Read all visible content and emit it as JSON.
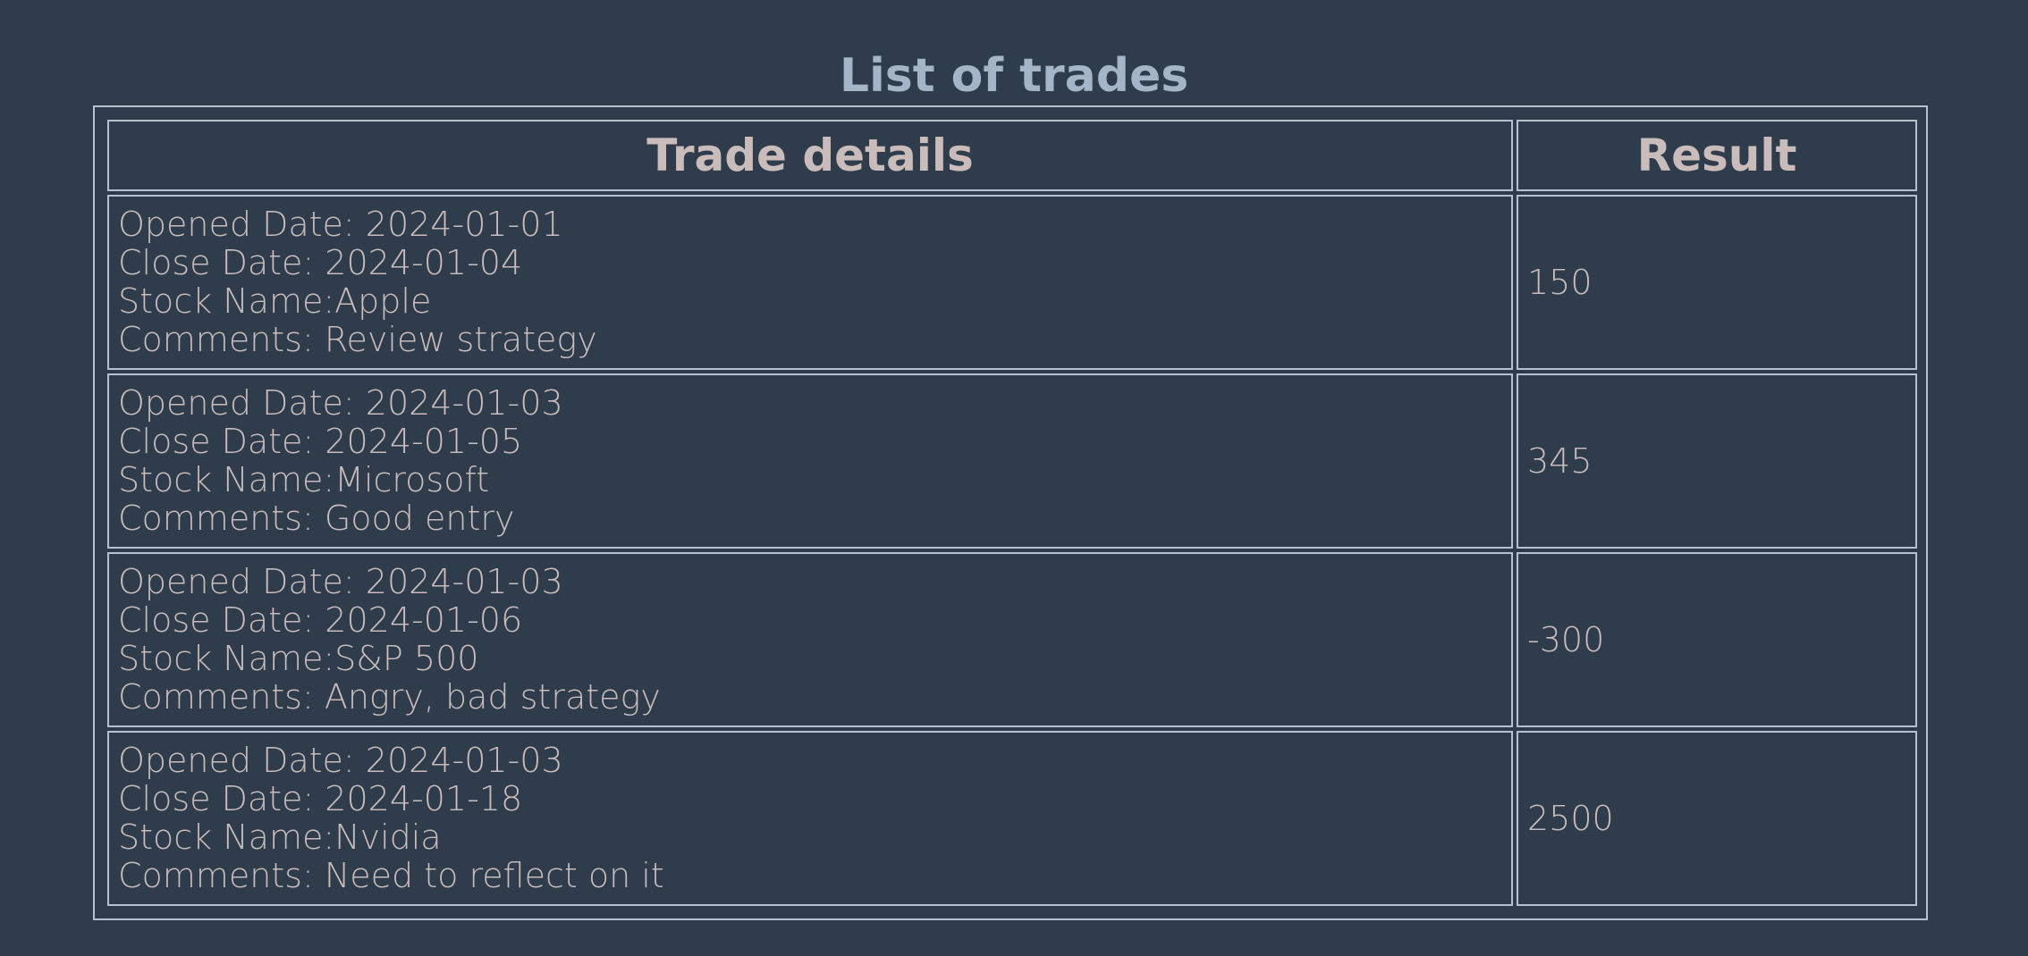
{
  "page": {
    "title": "List of trades"
  },
  "table": {
    "headers": {
      "details": "Trade details",
      "result": "Result"
    },
    "rows": [
      {
        "opened": "Opened Date: 2024-01-01",
        "closed": "Close Date: 2024-01-04",
        "stock": "Stock Name:Apple",
        "comments": "Comments: Review strategy",
        "result": "150"
      },
      {
        "opened": "Opened Date: 2024-01-03",
        "closed": "Close Date: 2024-01-05",
        "stock": "Stock Name:Microsoft",
        "comments": "Comments: Good entry",
        "result": "345"
      },
      {
        "opened": "Opened Date: 2024-01-03",
        "closed": "Close Date: 2024-01-06",
        "stock": "Stock Name:S&P 500",
        "comments": "Comments: Angry, bad strategy",
        "result": "-300"
      },
      {
        "opened": "Opened Date: 2024-01-03",
        "closed": "Close Date: 2024-01-18",
        "stock": "Stock Name:Nvidia",
        "comments": "Comments: Need to reflect on it",
        "result": "2500"
      }
    ]
  },
  "colors": {
    "background": "#2f3c4b",
    "title": "#a3b5c6",
    "text": "#c9bcba",
    "border": "#b6c3cf"
  }
}
